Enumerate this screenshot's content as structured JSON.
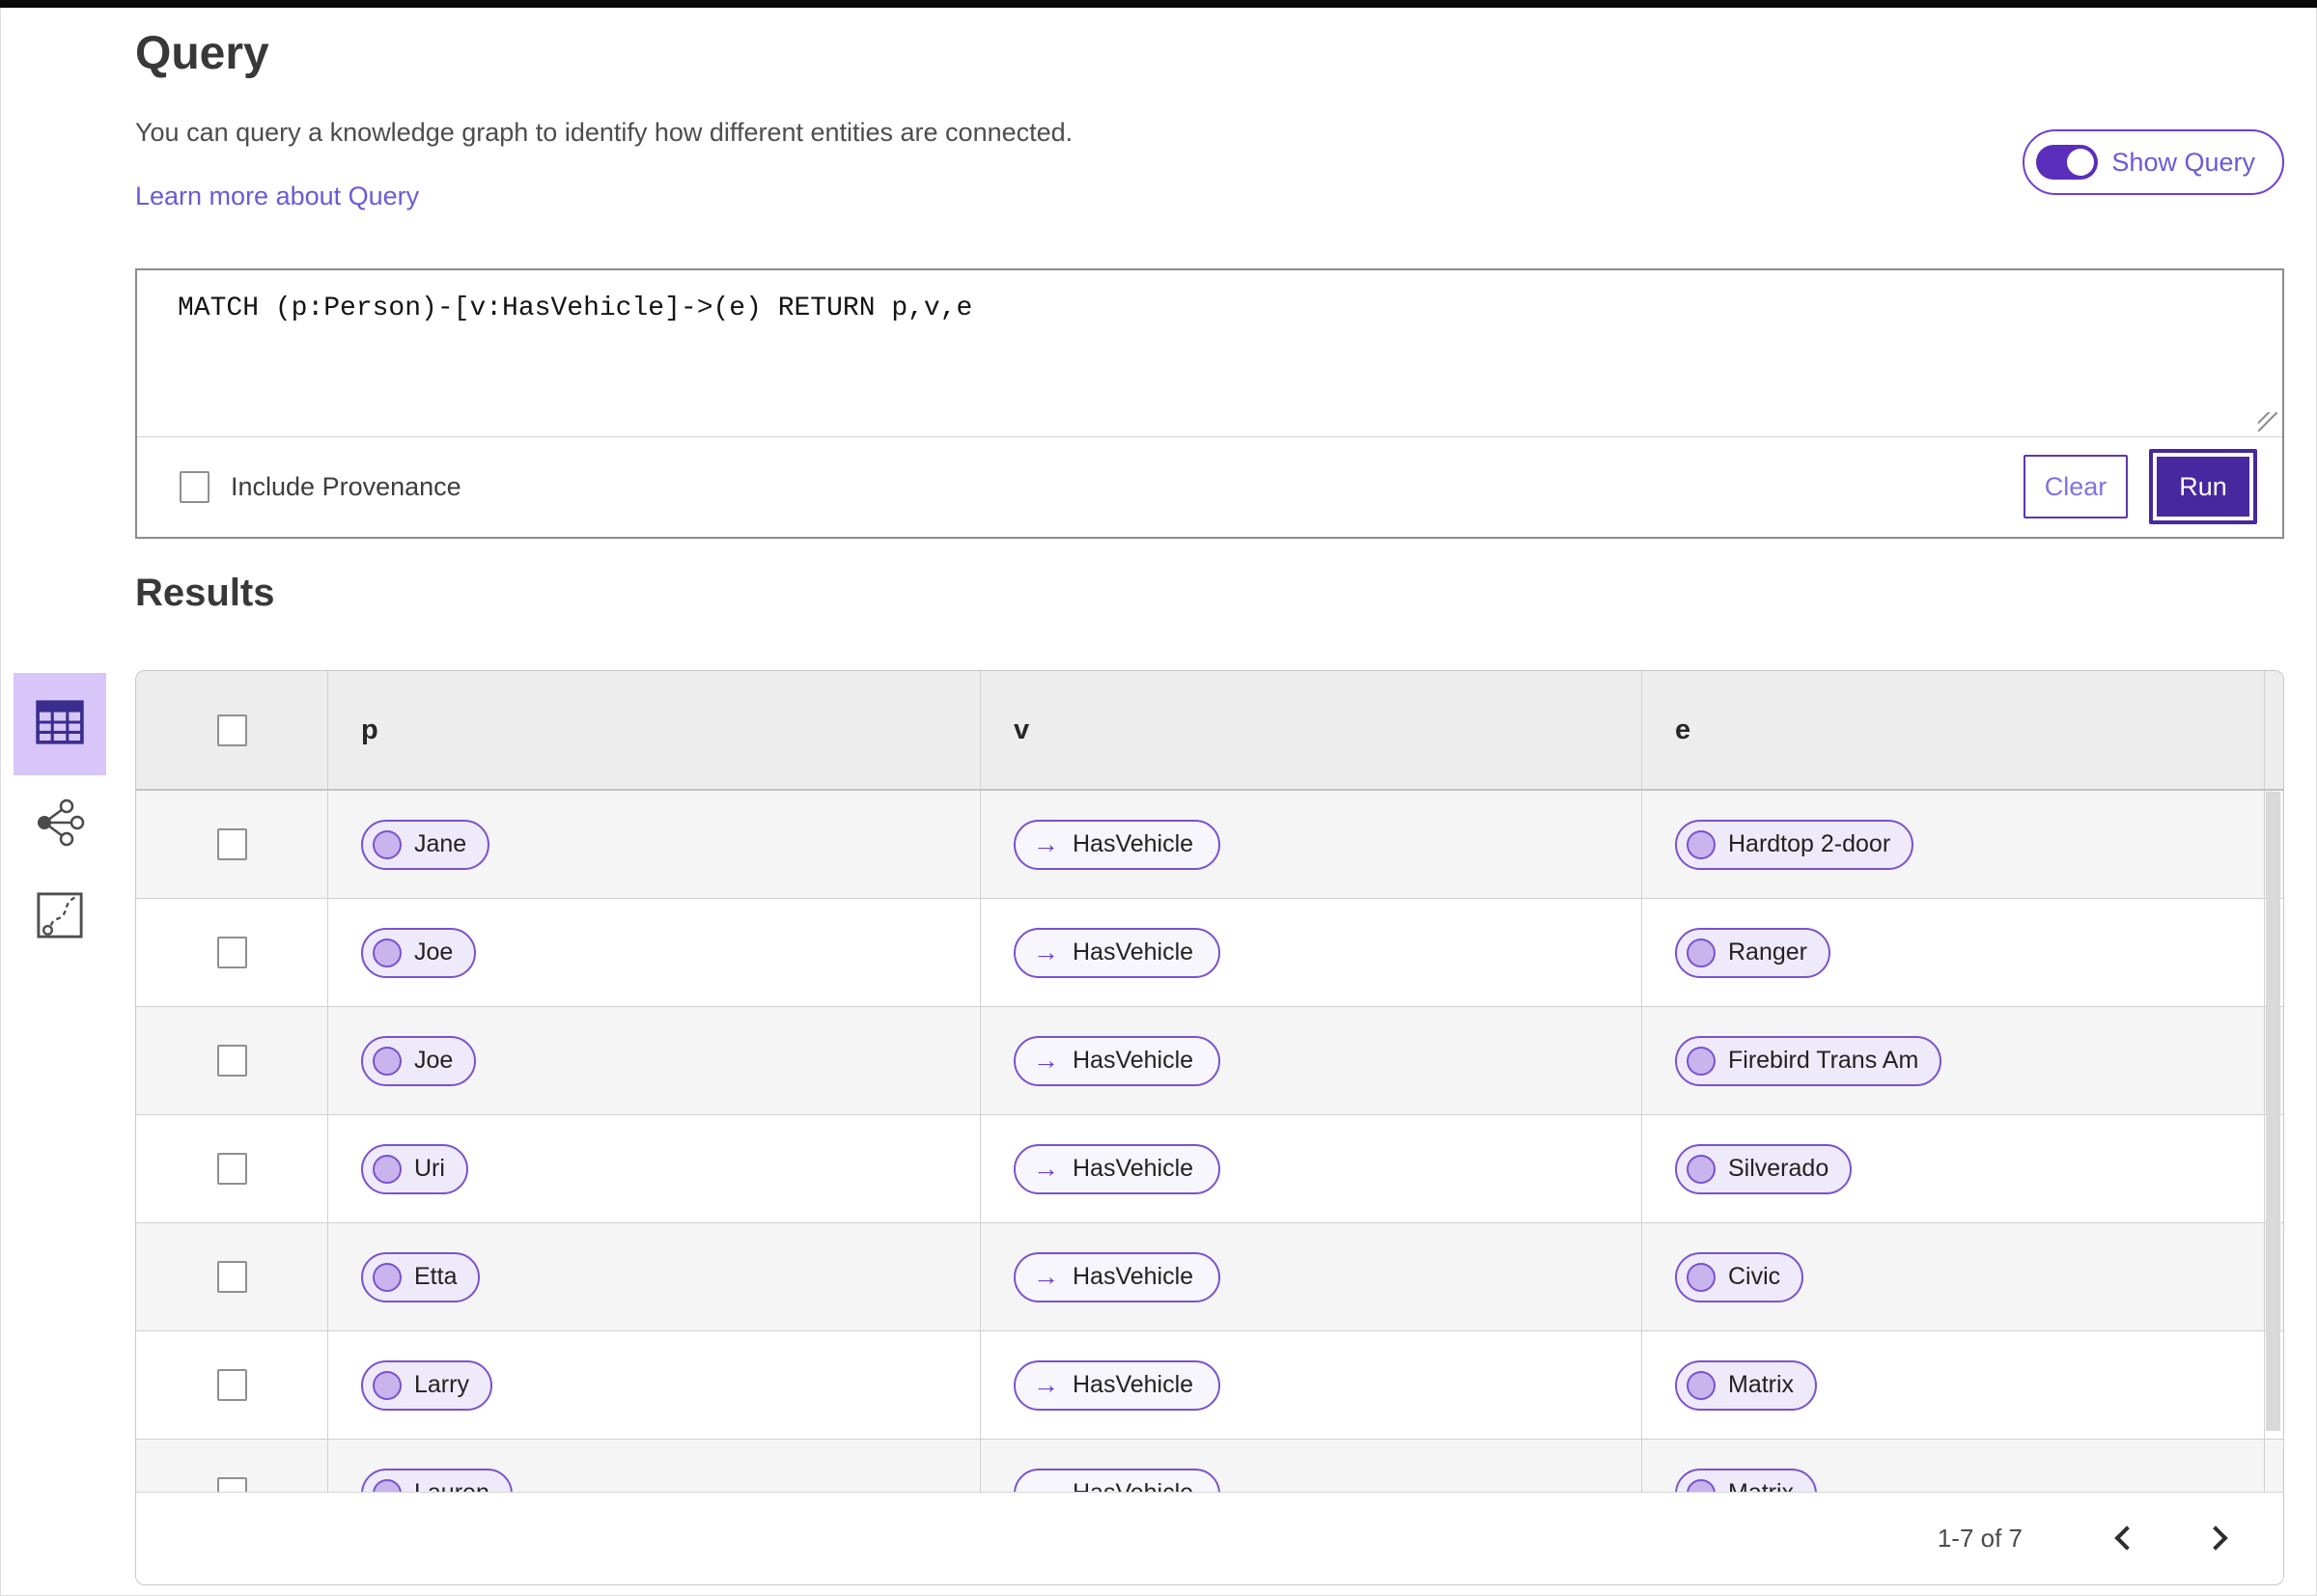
{
  "header": {
    "title": "Query",
    "description": "You can query a knowledge graph to identify how different entities are connected.",
    "learn_more_link": "Learn more about Query",
    "toggle_label": "Show Query",
    "toggle_on": true
  },
  "query": {
    "text": "MATCH (p:Person)-[v:HasVehicle]->(e) RETURN p,v,e",
    "include_provenance_label": "Include Provenance",
    "include_provenance_checked": false,
    "clear_label": "Clear",
    "run_label": "Run"
  },
  "results": {
    "heading": "Results",
    "view_switcher": [
      {
        "icon": "table-icon",
        "selected": true
      },
      {
        "icon": "share-nodes-icon",
        "selected": false
      },
      {
        "icon": "path-icon",
        "selected": false
      }
    ],
    "table": {
      "columns": [
        "p",
        "v",
        "e"
      ],
      "rows": [
        {
          "p": "Jane",
          "v": "HasVehicle",
          "e": "Hardtop 2-door"
        },
        {
          "p": "Joe",
          "v": "HasVehicle",
          "e": "Ranger"
        },
        {
          "p": "Joe",
          "v": "HasVehicle",
          "e": "Firebird Trans Am"
        },
        {
          "p": "Uri",
          "v": "HasVehicle",
          "e": "Silverado"
        },
        {
          "p": "Etta",
          "v": "HasVehicle",
          "e": "Civic"
        },
        {
          "p": "Larry",
          "v": "HasVehicle",
          "e": "Matrix"
        },
        {
          "p": "Lauren",
          "v": "HasVehicle",
          "e": "Matrix"
        }
      ]
    },
    "pagination": {
      "label": "1-7 of 7"
    }
  },
  "icons": {
    "edge_arrow": "→"
  },
  "colors": {
    "accent_purple": "#47289f",
    "toggle_track_purple": "#5b2dbb",
    "pill_border_purple": "#7a52cf",
    "node_pill_bg": "#efeaf9",
    "node_circle_fill": "#c9b4ee",
    "edge_pill_bg": "#f8f6fd",
    "selected_view_bg": "#d8c6f8",
    "link_purple": "#6a5ad6",
    "header_gray": "#ededed",
    "row_stripe_gray": "#f5f5f5",
    "top_bar_black": "#0a0a0a"
  }
}
